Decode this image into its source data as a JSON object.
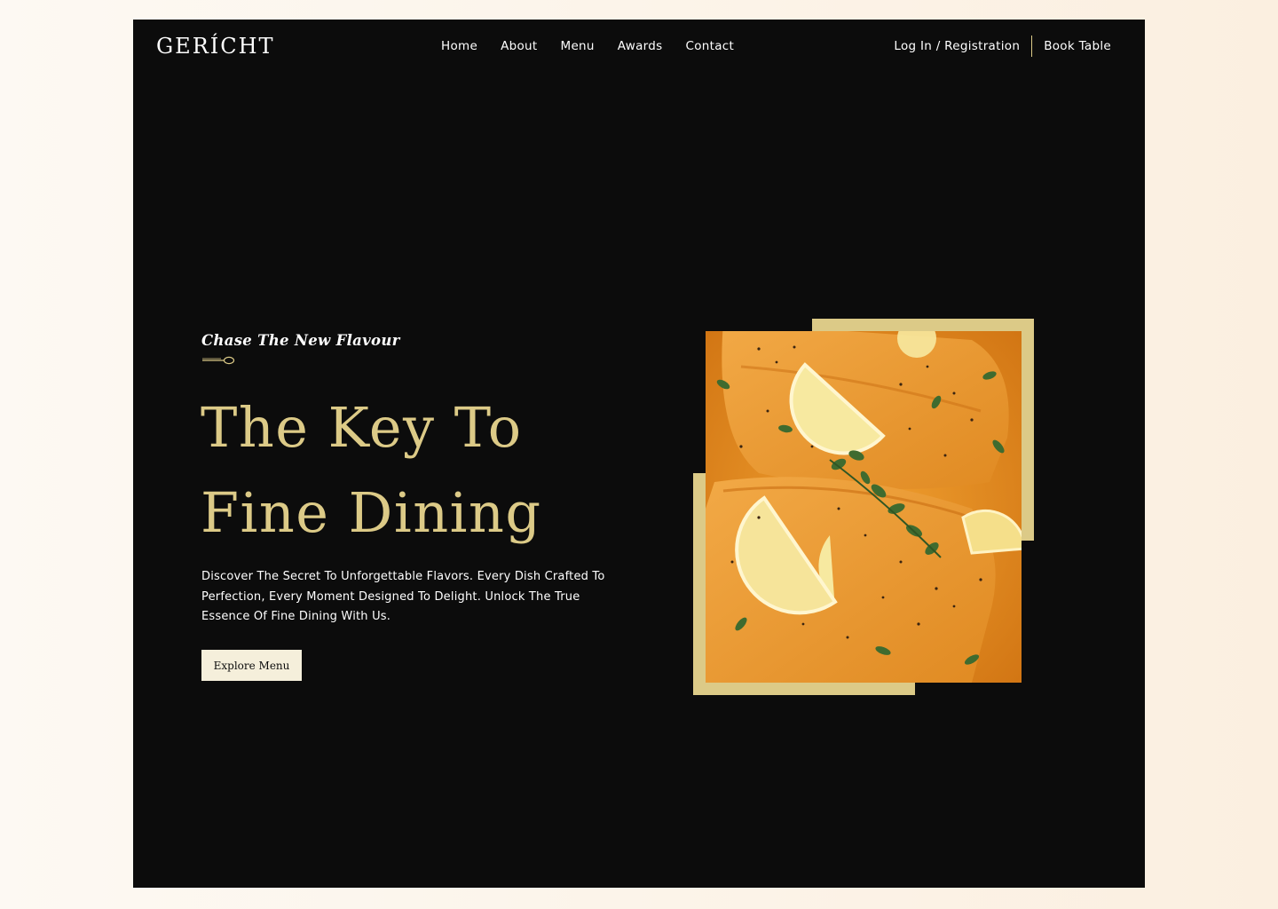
{
  "brand": {
    "logo": "GERÍCHT"
  },
  "nav": {
    "links": [
      "Home",
      "About",
      "Menu",
      "Awards",
      "Contact"
    ],
    "login": "Log In / Registration",
    "book": "Book Table"
  },
  "hero": {
    "subtitle": "Chase The New Flavour",
    "headline_line1": "The Key To",
    "headline_line2": "Fine Dining",
    "description": "Discover The Secret To Unforgettable Flavors. Every Dish Crafted To Perfection, Every Moment Designed To Delight. Unlock The True Essence Of Fine Dining With Us.",
    "cta": "Explore Menu"
  },
  "colors": {
    "background": "#0c0c0c",
    "gold": "#dcca87",
    "text": "#ffffff",
    "button": "#f5efdb"
  },
  "icons": {
    "spoon": "spoon-icon"
  }
}
